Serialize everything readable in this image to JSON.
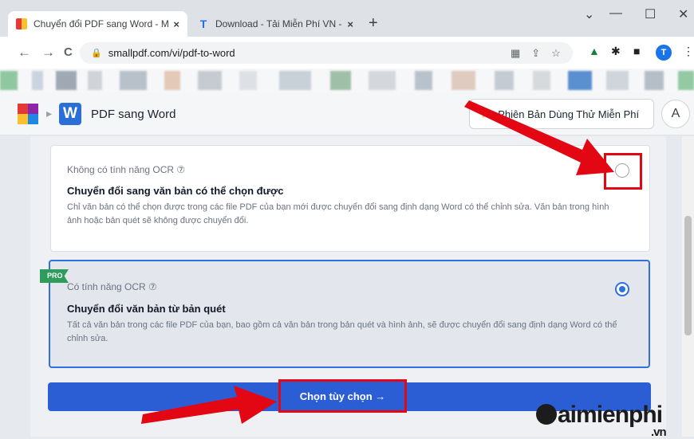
{
  "tabs": [
    {
      "title": "Chuyển đổi PDF sang Word - Mi",
      "close": "×"
    },
    {
      "title": "Download - Tải Miễn Phí VN - Ph",
      "close": "×"
    }
  ],
  "new_tab": "+",
  "window_controls": {
    "chevron": "⌄",
    "minimize": "—",
    "maximize": "☐",
    "close": "✕"
  },
  "address": {
    "back": "←",
    "forward": "→",
    "reload": "C",
    "url": "smallpdf.com/vi/pdf-to-word"
  },
  "page_header": {
    "tool_icon": "W",
    "title": "PDF sang Word",
    "trial_button": "Phiên Bản Dùng Thử Miễn Phí",
    "user_icon": "A"
  },
  "options": [
    {
      "label": "Không có tính năng OCR ⑦",
      "heading": "Chuyển đổi sang văn bản có thể chọn được",
      "description": "Chỉ văn bản có thể chọn được trong các file PDF của bạn mới được chuyển đổi sang định dạng Word có thể chỉnh sửa. Văn bản trong hình ảnh hoặc bản quét sẽ không được chuyển đổi.",
      "selected": false
    },
    {
      "badge": "PRO",
      "label": "Có tính năng OCR ⑦",
      "heading": "Chuyển đổi văn bản từ bản quét",
      "description": "Tất cả văn bản trong các file PDF của bạn, bao gồm cả văn bản trong bản quét và hình ảnh, sẽ được chuyển đổi sang định dạng Word có thể chỉnh sửa.",
      "selected": true
    }
  ],
  "action_button": "Chọn tùy chọn →",
  "watermark": {
    "main": "aimienphi",
    "sub": ".vn"
  },
  "colors": {
    "accent": "#2b5ed4",
    "highlight": "#e30613",
    "pro_badge": "#2e9d5b"
  }
}
